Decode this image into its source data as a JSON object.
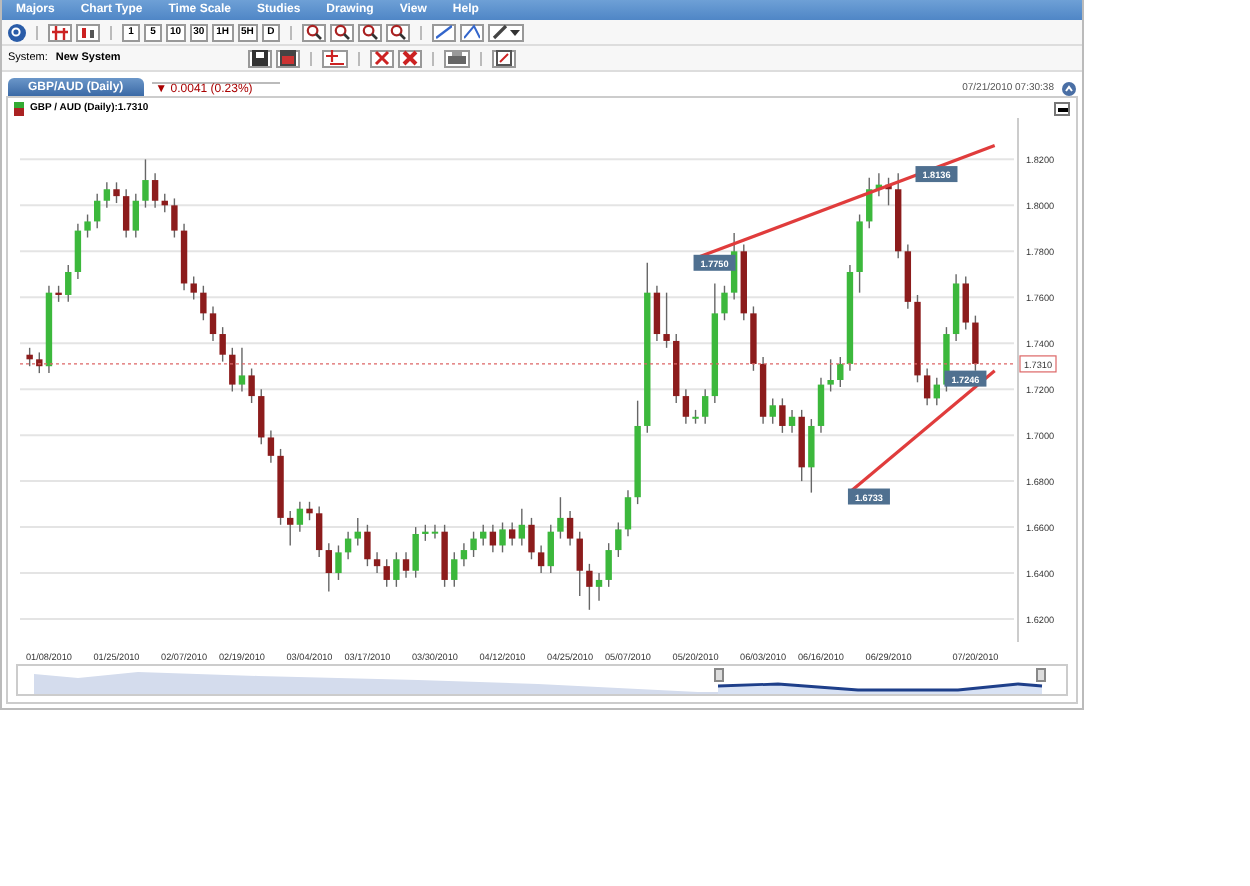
{
  "menu": [
    "Majors",
    "Chart Type",
    "Time Scale",
    "Studies",
    "Drawing",
    "View",
    "Help"
  ],
  "periods": [
    "1",
    "5",
    "10",
    "30",
    "1H",
    "5H",
    "D"
  ],
  "system": {
    "label": "System:",
    "value": "New System"
  },
  "tab": {
    "label": "GBP/AUD (Daily)",
    "change": "▼ 0.0041 (0.23%)"
  },
  "timestamp": "07/21/2010 07:30:38",
  "legend": "GBP / AUD (Daily):1.7310",
  "chart_data": {
    "type": "candlestick",
    "grid": true,
    "ylim": [
      1.61,
      1.838
    ],
    "yticks": [
      {
        "value": 1.62,
        "label": "1.6200"
      },
      {
        "value": 1.64,
        "label": "1.6400"
      },
      {
        "value": 1.66,
        "label": "1.6600"
      },
      {
        "value": 1.68,
        "label": "1.6800"
      },
      {
        "value": 1.7,
        "label": "1.7000"
      },
      {
        "value": 1.72,
        "label": "1.7200"
      },
      {
        "value": 1.74,
        "label": "1.7400"
      },
      {
        "value": 1.76,
        "label": "1.7600"
      },
      {
        "value": 1.78,
        "label": "1.7800"
      },
      {
        "value": 1.8,
        "label": "1.8000"
      },
      {
        "value": 1.82,
        "label": "1.8200"
      }
    ],
    "categories": [
      null,
      null,
      "01/08/2010",
      null,
      null,
      null,
      null,
      null,
      null,
      "01/25/2010",
      null,
      null,
      null,
      null,
      null,
      null,
      "02/07/2010",
      null,
      null,
      null,
      null,
      null,
      "02/19/2010",
      null,
      null,
      null,
      null,
      null,
      null,
      "03/04/2010",
      null,
      null,
      null,
      null,
      null,
      "03/17/2010",
      null,
      null,
      null,
      null,
      null,
      null,
      "03/30/2010",
      null,
      null,
      null,
      null,
      null,
      null,
      "04/12/2010",
      null,
      null,
      null,
      null,
      null,
      null,
      "04/25/2010",
      null,
      null,
      null,
      null,
      null,
      "05/07/2010",
      null,
      null,
      null,
      null,
      null,
      null,
      "05/20/2010",
      null,
      null,
      null,
      null,
      null,
      null,
      "06/03/2010",
      null,
      null,
      null,
      null,
      null,
      "06/16/2010",
      null,
      null,
      null,
      null,
      null,
      null,
      "06/29/2010",
      null,
      null,
      null,
      null,
      null,
      null,
      null,
      null,
      "07/20/2010"
    ],
    "ohlc": [
      [
        1.735,
        1.738,
        1.73,
        1.733
      ],
      [
        1.733,
        1.736,
        1.727,
        1.73
      ],
      [
        1.73,
        1.765,
        1.727,
        1.762
      ],
      [
        1.762,
        1.765,
        1.758,
        1.761
      ],
      [
        1.761,
        1.774,
        1.758,
        1.771
      ],
      [
        1.771,
        1.792,
        1.768,
        1.789
      ],
      [
        1.789,
        1.796,
        1.786,
        1.793
      ],
      [
        1.793,
        1.805,
        1.79,
        1.802
      ],
      [
        1.802,
        1.81,
        1.799,
        1.807
      ],
      [
        1.807,
        1.81,
        1.801,
        1.804
      ],
      [
        1.804,
        1.807,
        1.786,
        1.789
      ],
      [
        1.789,
        1.805,
        1.786,
        1.802
      ],
      [
        1.802,
        1.82,
        1.799,
        1.811
      ],
      [
        1.811,
        1.814,
        1.799,
        1.802
      ],
      [
        1.802,
        1.805,
        1.797,
        1.8
      ],
      [
        1.8,
        1.803,
        1.786,
        1.789
      ],
      [
        1.789,
        1.792,
        1.763,
        1.766
      ],
      [
        1.766,
        1.769,
        1.759,
        1.762
      ],
      [
        1.762,
        1.765,
        1.75,
        1.753
      ],
      [
        1.753,
        1.756,
        1.741,
        1.744
      ],
      [
        1.744,
        1.747,
        1.732,
        1.735
      ],
      [
        1.735,
        1.738,
        1.719,
        1.722
      ],
      [
        1.722,
        1.738,
        1.719,
        1.726
      ],
      [
        1.726,
        1.729,
        1.714,
        1.717
      ],
      [
        1.717,
        1.72,
        1.696,
        1.699
      ],
      [
        1.699,
        1.702,
        1.688,
        1.691
      ],
      [
        1.691,
        1.694,
        1.661,
        1.664
      ],
      [
        1.664,
        1.667,
        1.652,
        1.661
      ],
      [
        1.661,
        1.671,
        1.658,
        1.668
      ],
      [
        1.668,
        1.671,
        1.663,
        1.666
      ],
      [
        1.666,
        1.669,
        1.647,
        1.65
      ],
      [
        1.65,
        1.653,
        1.632,
        1.64
      ],
      [
        1.64,
        1.652,
        1.637,
        1.649
      ],
      [
        1.649,
        1.658,
        1.646,
        1.655
      ],
      [
        1.655,
        1.664,
        1.652,
        1.658
      ],
      [
        1.658,
        1.661,
        1.643,
        1.646
      ],
      [
        1.646,
        1.649,
        1.64,
        1.643
      ],
      [
        1.643,
        1.646,
        1.634,
        1.637
      ],
      [
        1.637,
        1.649,
        1.634,
        1.646
      ],
      [
        1.646,
        1.649,
        1.638,
        1.641
      ],
      [
        1.641,
        1.66,
        1.638,
        1.657
      ],
      [
        1.657,
        1.661,
        1.654,
        1.658
      ],
      [
        1.658,
        1.661,
        1.655,
        1.658
      ],
      [
        1.658,
        1.661,
        1.634,
        1.637
      ],
      [
        1.637,
        1.649,
        1.634,
        1.646
      ],
      [
        1.646,
        1.653,
        1.643,
        1.65
      ],
      [
        1.65,
        1.658,
        1.647,
        1.655
      ],
      [
        1.655,
        1.661,
        1.652,
        1.658
      ],
      [
        1.658,
        1.661,
        1.649,
        1.652
      ],
      [
        1.652,
        1.662,
        1.649,
        1.659
      ],
      [
        1.659,
        1.662,
        1.652,
        1.655
      ],
      [
        1.655,
        1.668,
        1.652,
        1.661
      ],
      [
        1.661,
        1.664,
        1.646,
        1.649
      ],
      [
        1.649,
        1.652,
        1.64,
        1.643
      ],
      [
        1.643,
        1.661,
        1.64,
        1.658
      ],
      [
        1.658,
        1.673,
        1.655,
        1.664
      ],
      [
        1.664,
        1.667,
        1.652,
        1.655
      ],
      [
        1.655,
        1.658,
        1.63,
        1.641
      ],
      [
        1.641,
        1.644,
        1.624,
        1.634
      ],
      [
        1.634,
        1.64,
        1.628,
        1.637
      ],
      [
        1.637,
        1.653,
        1.634,
        1.65
      ],
      [
        1.65,
        1.662,
        1.647,
        1.659
      ],
      [
        1.659,
        1.676,
        1.656,
        1.673
      ],
      [
        1.673,
        1.715,
        1.67,
        1.704
      ],
      [
        1.704,
        1.775,
        1.701,
        1.762
      ],
      [
        1.762,
        1.765,
        1.741,
        1.744
      ],
      [
        1.744,
        1.762,
        1.738,
        1.741
      ],
      [
        1.741,
        1.744,
        1.714,
        1.717
      ],
      [
        1.717,
        1.72,
        1.705,
        1.708
      ],
      [
        1.708,
        1.711,
        1.705,
        1.708
      ],
      [
        1.708,
        1.72,
        1.705,
        1.717
      ],
      [
        1.717,
        1.766,
        1.714,
        1.753
      ],
      [
        1.753,
        1.765,
        1.75,
        1.762
      ],
      [
        1.762,
        1.788,
        1.759,
        1.78
      ],
      [
        1.78,
        1.783,
        1.75,
        1.753
      ],
      [
        1.753,
        1.756,
        1.728,
        1.731
      ],
      [
        1.731,
        1.734,
        1.705,
        1.708
      ],
      [
        1.708,
        1.716,
        1.705,
        1.713
      ],
      [
        1.713,
        1.716,
        1.701,
        1.704
      ],
      [
        1.704,
        1.711,
        1.701,
        1.708
      ],
      [
        1.708,
        1.711,
        1.68,
        1.686
      ],
      [
        1.686,
        1.707,
        1.675,
        1.704
      ],
      [
        1.704,
        1.725,
        1.701,
        1.722
      ],
      [
        1.722,
        1.733,
        1.719,
        1.724
      ],
      [
        1.724,
        1.734,
        1.721,
        1.731
      ],
      [
        1.731,
        1.774,
        1.728,
        1.771
      ],
      [
        1.771,
        1.796,
        1.762,
        1.793
      ],
      [
        1.793,
        1.812,
        1.79,
        1.807
      ],
      [
        1.807,
        1.814,
        1.804,
        1.809
      ],
      [
        1.809,
        1.812,
        1.8,
        1.807
      ],
      [
        1.807,
        1.814,
        1.777,
        1.78
      ],
      [
        1.78,
        1.783,
        1.755,
        1.758
      ],
      [
        1.758,
        1.761,
        1.723,
        1.726
      ],
      [
        1.726,
        1.729,
        1.713,
        1.716
      ],
      [
        1.716,
        1.725,
        1.713,
        1.722
      ],
      [
        1.722,
        1.747,
        1.719,
        1.744
      ],
      [
        1.744,
        1.77,
        1.741,
        1.766
      ],
      [
        1.766,
        1.769,
        1.746,
        1.749
      ],
      [
        1.749,
        1.752,
        1.728,
        1.731
      ]
    ],
    "annotations": [
      "1.7750",
      "1.8136",
      "1.6733",
      "1.7246"
    ],
    "ref_lines": [
      {
        "axis": "y",
        "value": 1.731,
        "label": "1.7310"
      }
    ]
  }
}
